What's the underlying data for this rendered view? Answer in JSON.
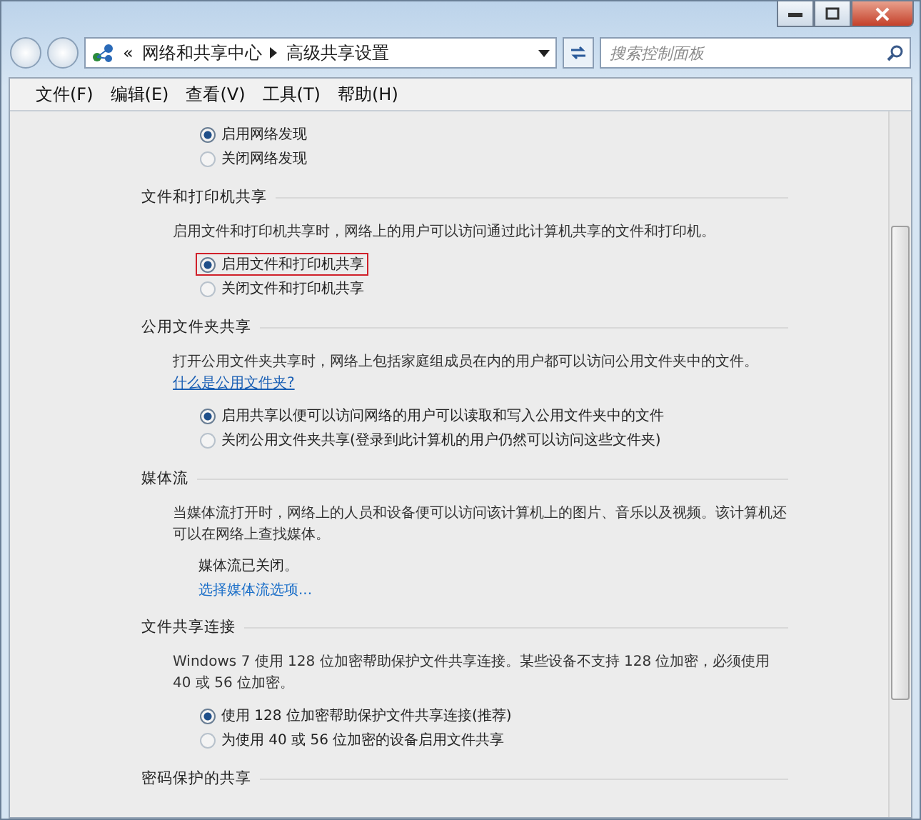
{
  "address_bar": {
    "overflow": "«",
    "crumbs": [
      "网络和共享中心",
      "高级共享设置"
    ]
  },
  "search": {
    "placeholder": "搜索控制面板"
  },
  "menu": [
    "文件(F)",
    "编辑(E)",
    "查看(V)",
    "工具(T)",
    "帮助(H)"
  ],
  "sections": [
    {
      "kind": "options",
      "options": [
        {
          "label": "启用网络发现",
          "selected": true,
          "highlighted": false
        },
        {
          "label": "关闭网络发现",
          "selected": false,
          "highlighted": false
        }
      ]
    },
    {
      "kind": "options",
      "heading": "文件和打印机共享",
      "description": "启用文件和打印机共享时，网络上的用户可以访问通过此计算机共享的文件和打印机。",
      "options": [
        {
          "label": "启用文件和打印机共享",
          "selected": true,
          "highlighted": true
        },
        {
          "label": "关闭文件和打印机共享",
          "selected": false,
          "highlighted": false
        }
      ]
    },
    {
      "kind": "options",
      "heading": "公用文件夹共享",
      "description": "打开公用文件夹共享时，网络上包括家庭组成员在内的用户都可以访问公用文件夹中的文件。",
      "link": "什么是公用文件夹?",
      "options": [
        {
          "label": "启用共享以便可以访问网络的用户可以读取和写入公用文件夹中的文件",
          "selected": true,
          "highlighted": false
        },
        {
          "label": "关闭公用文件夹共享(登录到此计算机的用户仍然可以访问这些文件夹)",
          "selected": false,
          "highlighted": false
        }
      ]
    },
    {
      "kind": "status",
      "heading": "媒体流",
      "description": "当媒体流打开时，网络上的人员和设备便可以访问该计算机上的图片、音乐以及视频。该计算机还可以在网络上查找媒体。",
      "status": "媒体流已关闭。",
      "action": "选择媒体流选项..."
    },
    {
      "kind": "options",
      "heading": "文件共享连接",
      "description": "Windows 7 使用 128 位加密帮助保护文件共享连接。某些设备不支持 128 位加密，必须使用 40 或 56 位加密。",
      "options": [
        {
          "label": "使用 128 位加密帮助保护文件共享连接(推荐)",
          "selected": true,
          "highlighted": false
        },
        {
          "label": "为使用 40 或 56 位加密的设备启用文件共享",
          "selected": false,
          "highlighted": false
        }
      ]
    },
    {
      "kind": "heading",
      "heading": "密码保护的共享"
    }
  ]
}
